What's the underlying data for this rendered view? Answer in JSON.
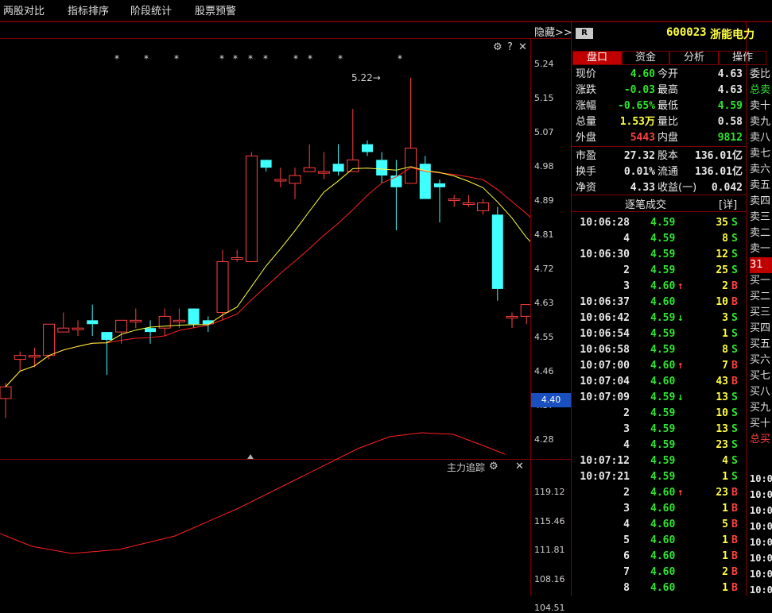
{
  "menu": [
    "两股对比",
    "指标排序",
    "阶段统计",
    "股票预警"
  ],
  "hide_label": "隐藏>>",
  "chart_controls": {
    "gear": "⚙",
    "help": "?",
    "close": "✕"
  },
  "sub_indicator": {
    "label": "主力追踪",
    "gear": "⚙",
    "close": "✕"
  },
  "price_axis": [
    "5.24",
    "5.15",
    "5.07",
    "4.98",
    "4.89",
    "4.81",
    "4.72",
    "4.63",
    "4.55",
    "4.46",
    "4.37",
    "4.28"
  ],
  "current_price_tag": "4.40",
  "max_marker": "5.22",
  "sub_axis": [
    "119.12",
    "115.46",
    "111.81",
    "108.16",
    "104.51"
  ],
  "stock": {
    "badge": "R",
    "code": "600023",
    "name": "浙能电力"
  },
  "tabs": [
    "盘口",
    "资金",
    "分析",
    "操作"
  ],
  "quote": [
    {
      "l1": "现价",
      "v1": "4.60",
      "c1": "green",
      "l2": "今开",
      "v2": "4.63",
      "c2": "white"
    },
    {
      "l1": "涨跌",
      "v1": "-0.03",
      "c1": "green",
      "l2": "最高",
      "v2": "4.63",
      "c2": "white"
    },
    {
      "l1": "涨幅",
      "v1": "-0.65%",
      "c1": "green",
      "l2": "最低",
      "v2": "4.59",
      "c2": "green"
    },
    {
      "l1": "总量",
      "v1": "1.53万",
      "c1": "yellow",
      "l2": "量比",
      "v2": "0.58",
      "c2": "white"
    },
    {
      "l1": "外盘",
      "v1": "5443",
      "c1": "red",
      "l2": "内盘",
      "v2": "9812",
      "c2": "green"
    },
    {
      "l1": "市盈",
      "v1": "27.32",
      "c1": "white",
      "l2": "股本",
      "v2": "136.01亿",
      "c2": "white"
    },
    {
      "l1": "换手",
      "v1": "0.01%",
      "c1": "white",
      "l2": "流通",
      "v2": "136.01亿",
      "c2": "white"
    },
    {
      "l1": "净资",
      "v1": "4.33",
      "c1": "white",
      "l2": "收益(一)",
      "v2": "0.042",
      "c2": "white"
    }
  ],
  "ticks_header": {
    "title": "逐笔成交",
    "detail": "[详]"
  },
  "ticks": [
    {
      "time": "10:06:28",
      "price": "4.59",
      "pc": "green",
      "arrow": "",
      "vol": "35",
      "side": "S"
    },
    {
      "time": "4",
      "price": "4.59",
      "pc": "green",
      "arrow": "",
      "vol": "8",
      "side": "S"
    },
    {
      "time": "10:06:30",
      "price": "4.59",
      "pc": "green",
      "arrow": "",
      "vol": "12",
      "side": "S"
    },
    {
      "time": "2",
      "price": "4.59",
      "pc": "green",
      "arrow": "",
      "vol": "25",
      "side": "S"
    },
    {
      "time": "3",
      "price": "4.60",
      "pc": "green",
      "arrow": "↑",
      "vol": "2",
      "side": "B"
    },
    {
      "time": "10:06:37",
      "price": "4.60",
      "pc": "green",
      "arrow": "",
      "vol": "10",
      "side": "B"
    },
    {
      "time": "10:06:42",
      "price": "4.59",
      "pc": "green",
      "arrow": "↓",
      "vol": "3",
      "side": "S"
    },
    {
      "time": "10:06:54",
      "price": "4.59",
      "pc": "green",
      "arrow": "",
      "vol": "1",
      "side": "S"
    },
    {
      "time": "10:06:58",
      "price": "4.59",
      "pc": "green",
      "arrow": "",
      "vol": "8",
      "side": "S"
    },
    {
      "time": "10:07:00",
      "price": "4.60",
      "pc": "green",
      "arrow": "↑",
      "vol": "7",
      "side": "B"
    },
    {
      "time": "10:07:04",
      "price": "4.60",
      "pc": "green",
      "arrow": "",
      "vol": "43",
      "side": "B"
    },
    {
      "time": "10:07:09",
      "price": "4.59",
      "pc": "green",
      "arrow": "↓",
      "vol": "13",
      "side": "S"
    },
    {
      "time": "2",
      "price": "4.59",
      "pc": "green",
      "arrow": "",
      "vol": "10",
      "side": "S"
    },
    {
      "time": "3",
      "price": "4.59",
      "pc": "green",
      "arrow": "",
      "vol": "13",
      "side": "S"
    },
    {
      "time": "4",
      "price": "4.59",
      "pc": "green",
      "arrow": "",
      "vol": "23",
      "side": "S"
    },
    {
      "time": "10:07:12",
      "price": "4.59",
      "pc": "green",
      "arrow": "",
      "vol": "4",
      "side": "S"
    },
    {
      "time": "10:07:21",
      "price": "4.59",
      "pc": "green",
      "arrow": "",
      "vol": "1",
      "side": "S"
    },
    {
      "time": "2",
      "price": "4.60",
      "pc": "green",
      "arrow": "↑",
      "vol": "23",
      "side": "B"
    },
    {
      "time": "3",
      "price": "4.60",
      "pc": "green",
      "arrow": "",
      "vol": "1",
      "side": "B"
    },
    {
      "time": "4",
      "price": "4.60",
      "pc": "green",
      "arrow": "",
      "vol": "5",
      "side": "B"
    },
    {
      "time": "5",
      "price": "4.60",
      "pc": "green",
      "arrow": "",
      "vol": "1",
      "side": "B"
    },
    {
      "time": "6",
      "price": "4.60",
      "pc": "green",
      "arrow": "",
      "vol": "1",
      "side": "B"
    },
    {
      "time": "7",
      "price": "4.60",
      "pc": "green",
      "arrow": "",
      "vol": "2",
      "side": "B"
    },
    {
      "time": "8",
      "price": "4.60",
      "pc": "green",
      "arrow": "",
      "vol": "1",
      "side": "B"
    }
  ],
  "order_book_labels": [
    "委比",
    "总卖",
    "卖十",
    "卖九",
    "卖八",
    "卖七",
    "卖六",
    "卖五",
    "卖四",
    "卖三",
    "卖二",
    "卖一",
    "31",
    "买一",
    "买二",
    "买三",
    "买四",
    "买五",
    "买六",
    "买七",
    "买八",
    "买九",
    "买十",
    "总买"
  ],
  "side_times": [
    "10:0",
    "10:0",
    "10:0",
    "10:0",
    "10:0",
    "10:0",
    "10:0",
    "10:0"
  ],
  "colors": {
    "up": "#ff4040",
    "down": "#40ffff",
    "ma_yellow": "#ffff40",
    "ma_red": "#ff2020",
    "grid": "#7a0000"
  },
  "candles": [
    {
      "o": 4.4,
      "h": 4.44,
      "l": 4.35,
      "c": 4.43
    },
    {
      "o": 4.5,
      "h": 4.52,
      "l": 4.47,
      "c": 4.51
    },
    {
      "o": 4.51,
      "h": 4.53,
      "l": 4.48,
      "c": 4.51
    },
    {
      "o": 4.51,
      "h": 4.59,
      "l": 4.5,
      "c": 4.59
    },
    {
      "o": 4.57,
      "h": 4.62,
      "l": 4.57,
      "c": 4.58
    },
    {
      "o": 4.58,
      "h": 4.6,
      "l": 4.56,
      "c": 4.58
    },
    {
      "o": 4.6,
      "h": 4.64,
      "l": 4.56,
      "c": 4.59
    },
    {
      "o": 4.57,
      "h": 4.57,
      "l": 4.46,
      "c": 4.55
    },
    {
      "o": 4.57,
      "h": 4.6,
      "l": 4.54,
      "c": 4.6
    },
    {
      "o": 4.6,
      "h": 4.63,
      "l": 4.58,
      "c": 4.6
    },
    {
      "o": 4.58,
      "h": 4.6,
      "l": 4.54,
      "c": 4.57
    },
    {
      "o": 4.58,
      "h": 4.63,
      "l": 4.56,
      "c": 4.61
    },
    {
      "o": 4.6,
      "h": 4.63,
      "l": 4.58,
      "c": 4.6
    },
    {
      "o": 4.63,
      "h": 4.63,
      "l": 4.58,
      "c": 4.59
    },
    {
      "o": 4.6,
      "h": 4.61,
      "l": 4.57,
      "c": 4.59
    },
    {
      "o": 4.62,
      "h": 4.78,
      "l": 4.6,
      "c": 4.75
    },
    {
      "o": 4.76,
      "h": 4.78,
      "l": 4.75,
      "c": 4.76
    },
    {
      "o": 4.75,
      "h": 5.03,
      "l": 4.75,
      "c": 5.02
    },
    {
      "o": 5.01,
      "h": 5.01,
      "l": 4.98,
      "c": 4.99
    },
    {
      "o": 4.96,
      "h": 4.99,
      "l": 4.94,
      "c": 4.96
    },
    {
      "o": 4.95,
      "h": 4.99,
      "l": 4.91,
      "c": 4.97
    },
    {
      "o": 4.98,
      "h": 5.05,
      "l": 4.98,
      "c": 4.99
    },
    {
      "o": 4.98,
      "h": 5.03,
      "l": 4.96,
      "c": 4.98
    },
    {
      "o": 5.0,
      "h": 5.05,
      "l": 4.97,
      "c": 4.98
    },
    {
      "o": 4.98,
      "h": 5.14,
      "l": 4.98,
      "c": 5.01
    },
    {
      "o": 5.05,
      "h": 5.06,
      "l": 5.02,
      "c": 5.03
    },
    {
      "o": 5.01,
      "h": 5.03,
      "l": 4.95,
      "c": 4.97
    },
    {
      "o": 4.97,
      "h": 5.01,
      "l": 4.83,
      "c": 4.94
    },
    {
      "o": 4.95,
      "h": 5.22,
      "l": 4.95,
      "c": 5.04
    },
    {
      "o": 5.0,
      "h": 5.02,
      "l": 4.91,
      "c": 4.91
    },
    {
      "o": 4.95,
      "h": 4.96,
      "l": 4.85,
      "c": 4.94
    },
    {
      "o": 4.91,
      "h": 4.92,
      "l": 4.89,
      "c": 4.91
    },
    {
      "o": 4.9,
      "h": 4.92,
      "l": 4.89,
      "c": 4.9
    },
    {
      "o": 4.88,
      "h": 4.91,
      "l": 4.87,
      "c": 4.9
    },
    {
      "o": 4.87,
      "h": 4.89,
      "l": 4.65,
      "c": 4.68
    },
    {
      "o": 4.61,
      "h": 4.62,
      "l": 4.58,
      "c": 4.61
    },
    {
      "o": 4.61,
      "h": 4.64,
      "l": 4.59,
      "c": 4.64
    },
    {
      "o": 4.63,
      "h": 4.63,
      "l": 4.61,
      "c": 4.61
    }
  ]
}
